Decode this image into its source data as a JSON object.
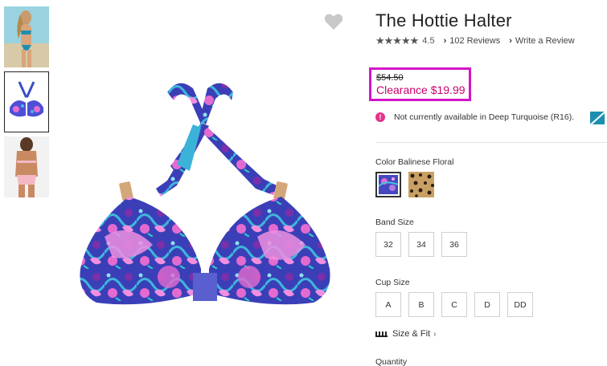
{
  "product": {
    "title": "The Hottie Halter",
    "rating": "4.5",
    "stars": "★★★★★",
    "reviews_link": "102 Reviews",
    "write_review_link": "Write a Review",
    "old_price": "$54.50",
    "clearance_price": "Clearance $19.99",
    "availability_message": "Not currently available in Deep Turquoise (R16).",
    "availability_icon": "!"
  },
  "color": {
    "label": "Color Balinese Floral",
    "swatches": [
      "balinese-floral",
      "leopard"
    ]
  },
  "band_size": {
    "label": "Band Size",
    "options": [
      "32",
      "34",
      "36"
    ]
  },
  "cup_size": {
    "label": "Cup Size",
    "options": [
      "A",
      "B",
      "C",
      "D",
      "DD"
    ]
  },
  "size_fit": {
    "label": "Size & Fit"
  },
  "quantity": {
    "label": "Quantity"
  },
  "colors": {
    "clearance": "#c8006e",
    "highlight_border": "#d514c9",
    "alert": "#e2338a",
    "unavailable_swatch": "#1c8fb0"
  },
  "icons": {
    "favorite": "heart-icon",
    "review_arrow": "chevron-right-icon",
    "size_fit": "ruler-icon"
  }
}
